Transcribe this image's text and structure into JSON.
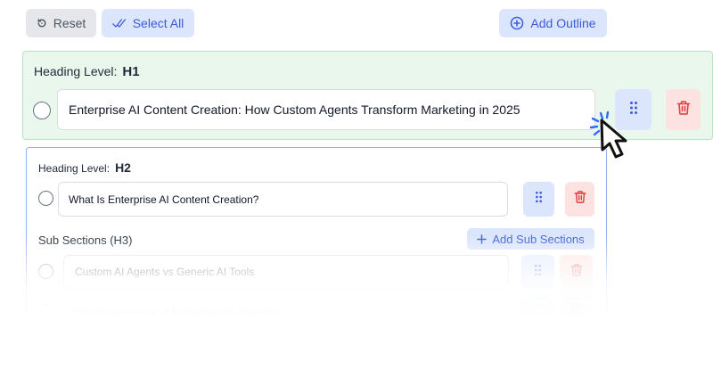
{
  "toolbar": {
    "reset_label": "Reset",
    "select_all_label": "Select All",
    "add_outline_label": "Add Outline"
  },
  "h1_section": {
    "heading_level_label": "Heading Level:",
    "heading_level_value": "H1",
    "title_value": "Enterprise AI Content Creation: How Custom Agents Transform Marketing in 2025"
  },
  "h2_section": {
    "heading_level_label": "Heading Level:",
    "heading_level_value": "H2",
    "title_value": "What Is Enterprise AI Content Creation?",
    "sub_sections_label": "Sub Sections (H3)",
    "add_sub_sections_label": "Add Sub Sections",
    "sub_sections": [
      {
        "title": "Custom AI Agents vs Generic AI Tools"
      },
      {
        "title": "Key Components of Enterprise AI Systems"
      }
    ]
  },
  "colors": {
    "accent_blue": "#3b5bdb",
    "danger_red": "#e03e3e",
    "h1_card_bg": "#e9f7ec",
    "h2_card_border": "#93b3ef"
  },
  "icons": {
    "reset": "rotate-ccw-icon",
    "select_all": "double-check-icon",
    "add": "plus-circle-icon",
    "drag": "drag-handle-icon",
    "delete": "trash-icon",
    "cursor": "pointer-cursor-icon"
  }
}
